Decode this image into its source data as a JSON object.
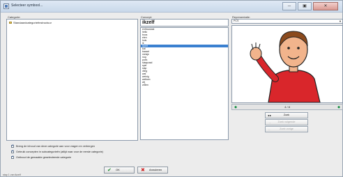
{
  "window": {
    "title": "Selecteer symbool...",
    "min_label": "─",
    "max_label": "▣",
    "close_label": "✕"
  },
  "labels": {
    "categories": "Categorie:",
    "concepts": "Concept:",
    "representation": "Representatie:"
  },
  "category_tree": {
    "item": "Standaardcategorieënstructuur"
  },
  "search": {
    "value": "ikzelf"
  },
  "concepts": [
    "enthousiast",
    "hello",
    "boos",
    "eten",
    "huis",
    "ik",
    "ikzelf",
    "kat",
    "kwaad",
    "meisje",
    "nog",
    "poes",
    "slaapzaal",
    "spel",
    "stap",
    "vlieg",
    "wat",
    "weinig",
    "welkom",
    "wij",
    "zeilen"
  ],
  "selected_concept_index": 6,
  "representation": {
    "selected": "PCS",
    "arrow": "▼"
  },
  "pager": {
    "text": "4 / 8",
    "prev": "◆",
    "next": "◆"
  },
  "buttons": {
    "zoek": "Zoek",
    "zoek_volgende": "Zoek volgende",
    "zoek_vorige": "Zoek vorige",
    "ok": "OK",
    "annuleren": "Annuleren"
  },
  "options": [
    "Breng de inhoud van deze categorie aan voor vragen en verbergen",
    "Gebruik concepten in subcategorieën (altijd naar voor de eerste categorie)",
    "Onthoud de gemaakte geselecteerde categorie"
  ],
  "status": "stap 1 van ikzelf",
  "colors": {
    "selection": "#3a80d0",
    "shirt": "#d9262b",
    "skin": "#f2b48c",
    "hair": "#8b4a1d",
    "pager_arrow": "#0a8a3a",
    "ok_check": "#1a8a2a",
    "cancel_x": "#cc1f1f"
  }
}
